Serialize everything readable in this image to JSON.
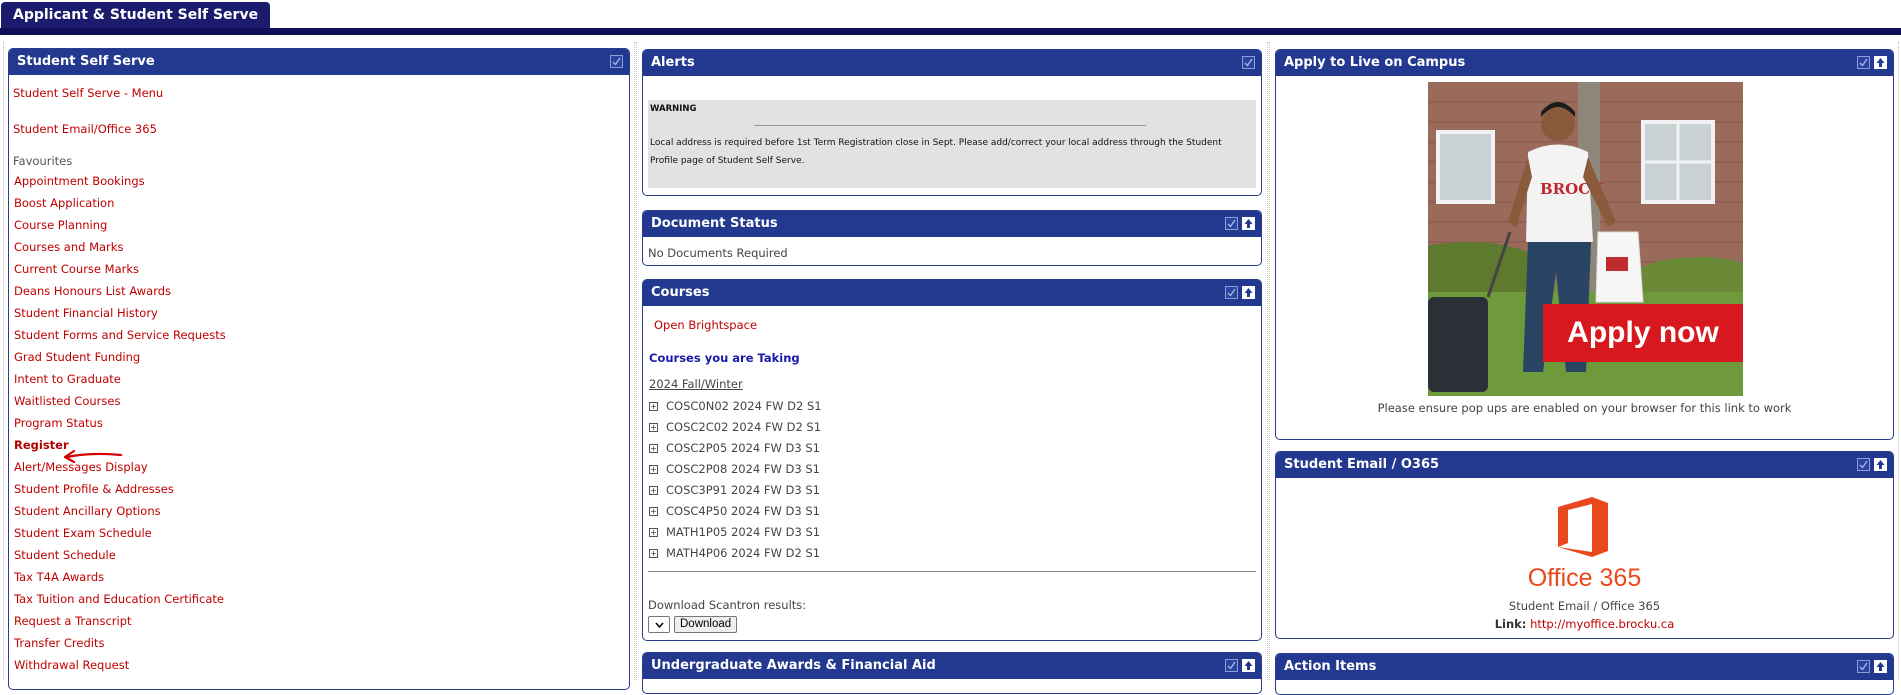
{
  "header": {
    "tab_label": "Applicant & Student Self Serve"
  },
  "left": {
    "title": "Student Self Serve",
    "menu_link": "Student Self Serve - Menu",
    "email_link": "Student Email/Office 365",
    "favourites_label": "Favourites",
    "items": [
      "Appointment Bookings",
      "Boost Application",
      "Course Planning",
      "Courses and Marks",
      "Current Course Marks",
      "Deans Honours List Awards",
      "Student Financial History",
      "Student Forms and Service Requests",
      "Grad Student Funding",
      "Intent to Graduate",
      "Waitlisted Courses",
      "Program Status",
      "Register",
      "Alert/Messages Display",
      "Student Profile & Addresses",
      "Student Ancillary Options",
      "Student Exam Schedule",
      "Student Schedule",
      "Tax T4A Awards",
      "Tax Tuition and Education Certificate",
      "Request a Transcript",
      "Transfer Credits",
      "Withdrawal Request"
    ]
  },
  "alerts": {
    "title": "Alerts",
    "warning_label": "WARNING",
    "warning_text": "Local address is required before 1st Term Registration close in Sept. Please add/correct your local address through the Student Profile page of Student Self Serve."
  },
  "document_status": {
    "title": "Document Status",
    "text": "No Documents Required"
  },
  "courses": {
    "title": "Courses",
    "brightspace_link": "Open Brightspace",
    "taking_label": "Courses you are Taking",
    "term": "2024 Fall/Winter",
    "list": [
      "COSC0N02 2024 FW D2 S1",
      "COSC2C02 2024 FW D2 S1",
      "COSC2P05 2024 FW D3 S1",
      "COSC2P08 2024 FW D3 S1",
      "COSC3P91 2024 FW D3 S1",
      "COSC4P50 2024 FW D3 S1",
      "MATH1P05 2024 FW D3 S1",
      "MATH4P06 2024 FW D2 S1"
    ],
    "download_label": "Download Scantron results:",
    "download_button": "Download"
  },
  "awards": {
    "title": "Undergraduate Awards & Financial Aid"
  },
  "campus": {
    "title": "Apply to Live on Campus",
    "banner_text": "Apply now",
    "shirt_text": "BROCK",
    "note": "Please ensure pop ups are enabled on your browser for this link to work"
  },
  "email": {
    "title": "Student Email / O365",
    "logo_text": "Office 365",
    "caption": "Student Email / Office 365",
    "link_label": "Link:",
    "link_url": "http://myoffice.brocku.ca"
  },
  "action_items": {
    "title": "Action Items"
  },
  "colors": {
    "header_blue": "#23398f",
    "link_red": "#c00000",
    "office_orange": "#e8481c",
    "banner_red": "#d7191f"
  },
  "icons": [
    "checkbox-icon",
    "collapse-icon",
    "expand-plus-icon",
    "red-arrow-annotation"
  ]
}
